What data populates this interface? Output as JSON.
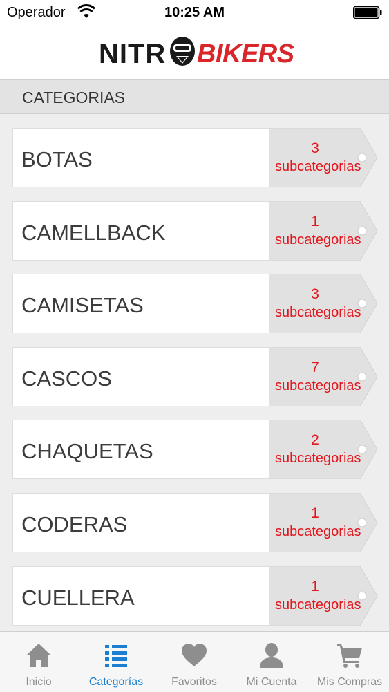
{
  "status_bar": {
    "carrier": "Operador",
    "time": "10:25 AM"
  },
  "header": {
    "logo_part1": "NITR",
    "logo_part2": "BIKERS",
    "logo_icon": "helmet-icon"
  },
  "section": {
    "title": "CATEGORIAS"
  },
  "categories": [
    {
      "name": "BOTAS",
      "count": "3",
      "sub_label": "subcategorias"
    },
    {
      "name": "CAMELLBACK",
      "count": "1",
      "sub_label": "subcategorias"
    },
    {
      "name": "CAMISETAS",
      "count": "3",
      "sub_label": "subcategorias"
    },
    {
      "name": "CASCOS",
      "count": "7",
      "sub_label": "subcategorias"
    },
    {
      "name": "CHAQUETAS",
      "count": "2",
      "sub_label": "subcategorias"
    },
    {
      "name": "CODERAS",
      "count": "1",
      "sub_label": "subcategorias"
    },
    {
      "name": "CUELLERA",
      "count": "1",
      "sub_label": "subcategorias"
    }
  ],
  "tabs": [
    {
      "label": "Inicio",
      "icon": "home-icon",
      "active": false
    },
    {
      "label": "Categorías",
      "icon": "list-icon",
      "active": true
    },
    {
      "label": "Favoritos",
      "icon": "heart-icon",
      "active": false
    },
    {
      "label": "Mi Cuenta",
      "icon": "user-icon",
      "active": false
    },
    {
      "label": "Mis Compras",
      "icon": "cart-icon",
      "active": false
    }
  ],
  "colors": {
    "accent": "#1a7fd0",
    "brand_red": "#d9262a",
    "count_red": "#e3161d",
    "inactive_tab": "#8e8e8e"
  }
}
